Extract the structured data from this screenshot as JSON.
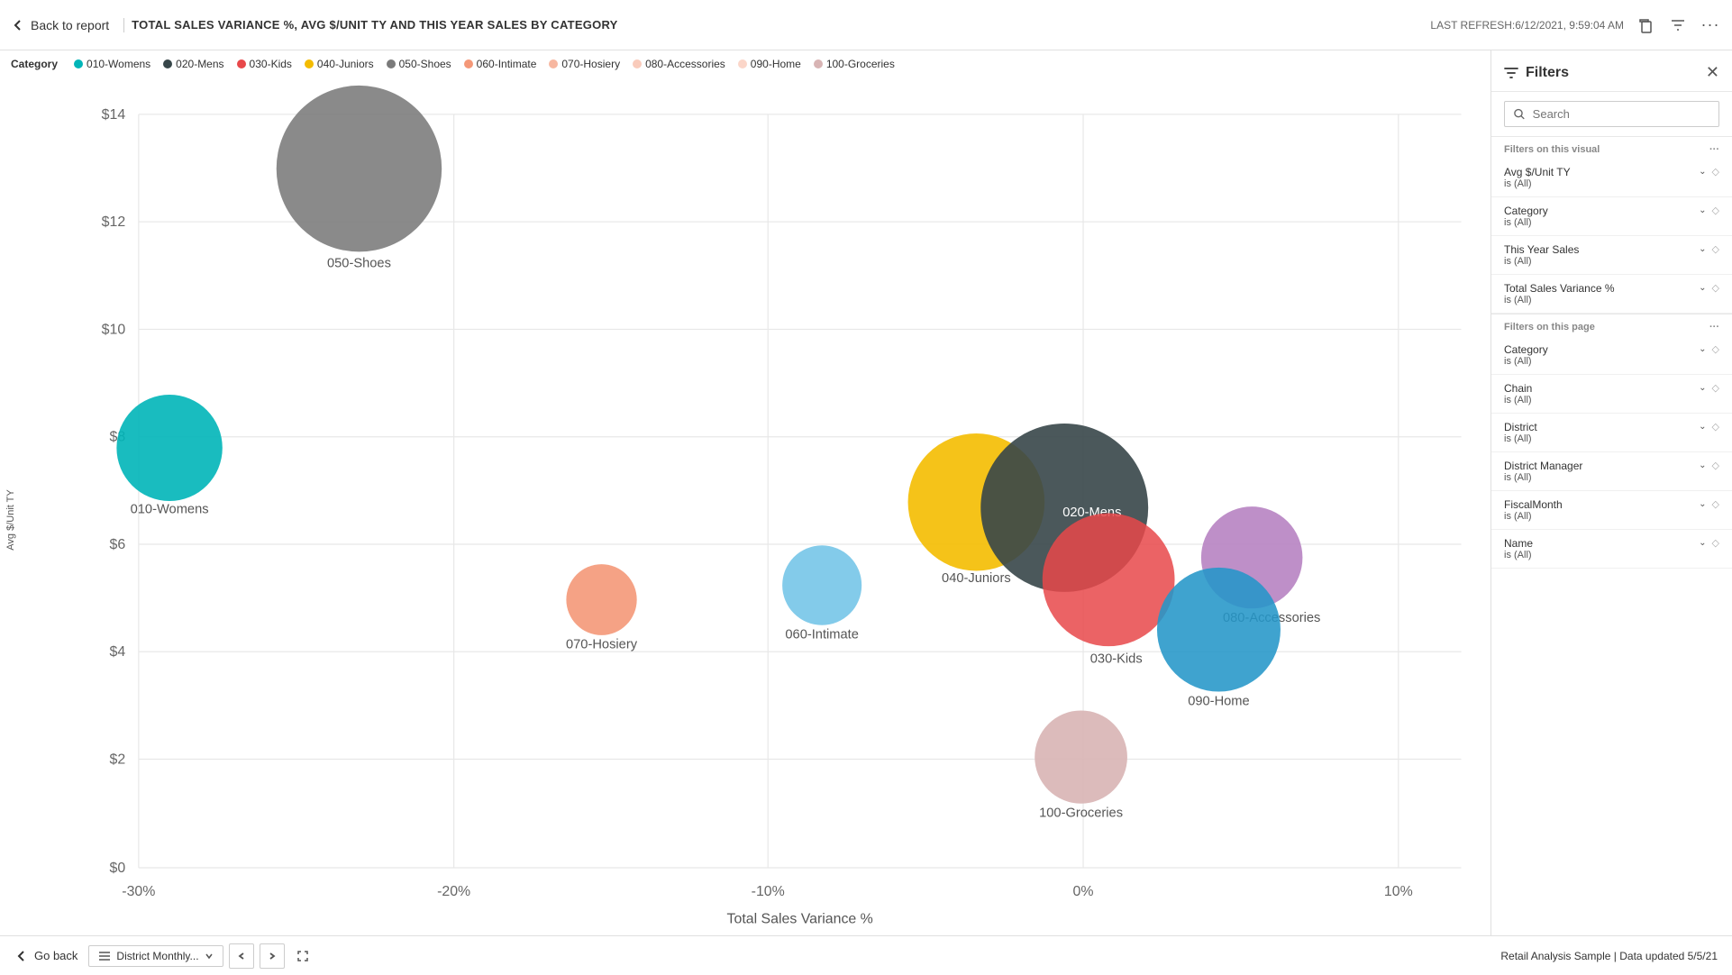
{
  "topbar": {
    "back_label": "Back to report",
    "chart_title": "TOTAL SALES VARIANCE %, AVG $/UNIT TY AND THIS YEAR SALES BY CATEGORY",
    "last_refresh": "LAST REFRESH:6/12/2021, 9:59:04 AM"
  },
  "legend": {
    "label": "Category",
    "items": [
      {
        "id": "010-Womens",
        "label": "010-Womens",
        "color": "#00B5B8"
      },
      {
        "id": "020-Mens",
        "label": "020-Mens",
        "color": "#374649"
      },
      {
        "id": "030-Kids",
        "label": "030-Kids",
        "color": "#E8484A"
      },
      {
        "id": "040-Juniors",
        "label": "040-Juniors",
        "color": "#F4BC00"
      },
      {
        "id": "050-Shoes",
        "label": "050-Shoes",
        "color": "#6A6A6A"
      },
      {
        "id": "060-Intimate",
        "label": "060-Intimate",
        "color": "#75C5E8"
      },
      {
        "id": "070-Hosiery",
        "label": "070-Hosiery",
        "color": "#F49878"
      },
      {
        "id": "080-Accessories",
        "label": "080-Accessories",
        "color": "#B580C0"
      },
      {
        "id": "090-Home",
        "label": "090-Home",
        "color": "#2496C8"
      },
      {
        "id": "100-Groceries",
        "label": "100-Groceries",
        "color": "#D8B4B4"
      }
    ]
  },
  "chart": {
    "y_axis_label": "Avg $/Unit TY",
    "x_axis_label": "Total Sales Variance %",
    "y_ticks": [
      "$14",
      "$12",
      "$10",
      "$8",
      "$6",
      "$4",
      "$2",
      "$0"
    ],
    "x_ticks": [
      "-30%",
      "-20%",
      "-10%",
      "0%",
      "10%"
    ],
    "bubbles": [
      {
        "id": "050-Shoes",
        "label": "050-Shoes",
        "x": 62,
        "y": 12,
        "r": 68,
        "color": "#7A7A7A"
      },
      {
        "id": "010-Womens",
        "label": "010-Womens",
        "x": 8,
        "y": 38,
        "r": 44,
        "color": "#00B5B8"
      },
      {
        "id": "040-Juniors",
        "label": "040-Juniors",
        "x": 74,
        "y": 44,
        "r": 58,
        "color": "#F4BC00"
      },
      {
        "id": "020-Mens",
        "label": "020-Mens",
        "x": 85,
        "y": 43,
        "r": 72,
        "color": "#374649"
      },
      {
        "id": "030-Kids",
        "label": "030-Kids",
        "x": 86,
        "y": 50,
        "r": 56,
        "color": "#E8484A"
      },
      {
        "id": "060-Intimate",
        "label": "060-Intimate",
        "x": 59,
        "y": 52,
        "r": 34,
        "color": "#75C5E8"
      },
      {
        "id": "070-Hosiery",
        "label": "070-Hosiery",
        "x": 47,
        "y": 54,
        "r": 30,
        "color": "#F49878"
      },
      {
        "id": "080-Accessories",
        "label": "080-Accessories",
        "x": 94,
        "y": 48,
        "r": 42,
        "color": "#B580C0"
      },
      {
        "id": "090-Home",
        "label": "090-Home",
        "x": 90,
        "y": 54,
        "r": 52,
        "color": "#2496C8"
      },
      {
        "id": "100-Groceries",
        "label": "100-Groceries",
        "x": 88,
        "y": 72,
        "r": 38,
        "color": "#D8B4B4"
      }
    ]
  },
  "filters": {
    "title": "Filters",
    "search_placeholder": "Search",
    "on_visual_label": "Filters on this visual",
    "on_page_label": "Filters on this page",
    "visual_filters": [
      {
        "name": "Avg $/Unit TY",
        "value": "is (All)"
      },
      {
        "name": "Category",
        "value": "is (All)"
      },
      {
        "name": "This Year Sales",
        "value": "is (All)"
      },
      {
        "name": "Total Sales Variance %",
        "value": "is (All)"
      }
    ],
    "page_filters": [
      {
        "name": "Category",
        "value": "is (All)"
      },
      {
        "name": "Chain",
        "value": "is (All)"
      },
      {
        "name": "District",
        "value": "is (All)"
      },
      {
        "name": "District Manager",
        "value": "is (All)"
      },
      {
        "name": "FiscalMonth",
        "value": "is (All)"
      },
      {
        "name": "Name",
        "value": "is (All)"
      }
    ]
  },
  "bottombar": {
    "go_back_label": "Go back",
    "page_tab_label": "District Monthly...",
    "report_name": "Retail Analysis Sample",
    "data_updated": "Data updated 5/5/21"
  }
}
